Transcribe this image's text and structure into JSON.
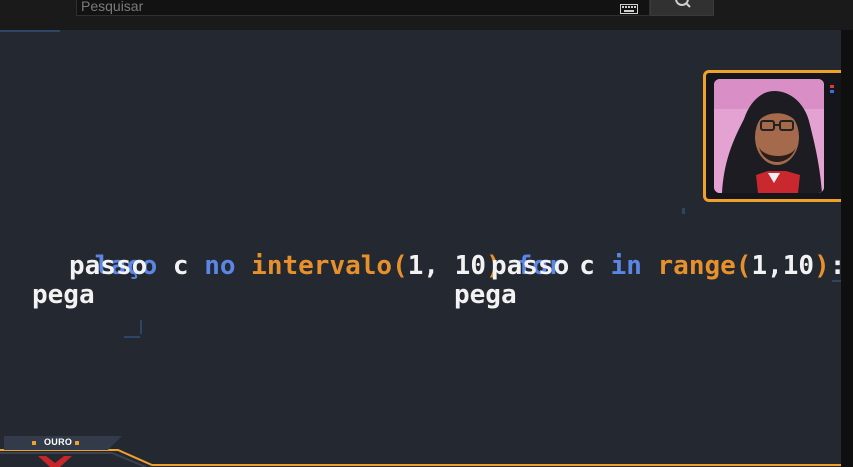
{
  "search": {
    "placeholder": "Pesquisar",
    "value": ""
  },
  "icons": {
    "keyboard": "keyboard-icon",
    "search": "search-icon"
  },
  "code_left": {
    "line1": [
      {
        "text": "laço",
        "role": "keyword"
      },
      {
        "text": " c ",
        "role": "plain"
      },
      {
        "text": "no",
        "role": "keyword"
      },
      {
        "text": " intervalo(",
        "role": "function"
      },
      {
        "text": "1, 10",
        "role": "plain"
      },
      {
        "text": ")",
        "role": "function"
      }
    ],
    "line2": "passo",
    "line3": "pega"
  },
  "code_right": {
    "line1": [
      {
        "text": "for",
        "role": "keyword"
      },
      {
        "text": " c ",
        "role": "plain"
      },
      {
        "text": "in",
        "role": "keyword"
      },
      {
        "text": " range(",
        "role": "function"
      },
      {
        "text": "1,10",
        "role": "plain"
      },
      {
        "text": ")",
        "role": "function"
      },
      {
        "text": ":",
        "role": "plain"
      }
    ],
    "line2": "passo",
    "line3": "pega"
  },
  "hud": {
    "rank_label": "OURO"
  },
  "colors": {
    "keyword": "#5b86e5",
    "function": "#e8912c",
    "plain": "#f2f2f2",
    "accent": "#f0a12a",
    "background": "#242830"
  }
}
